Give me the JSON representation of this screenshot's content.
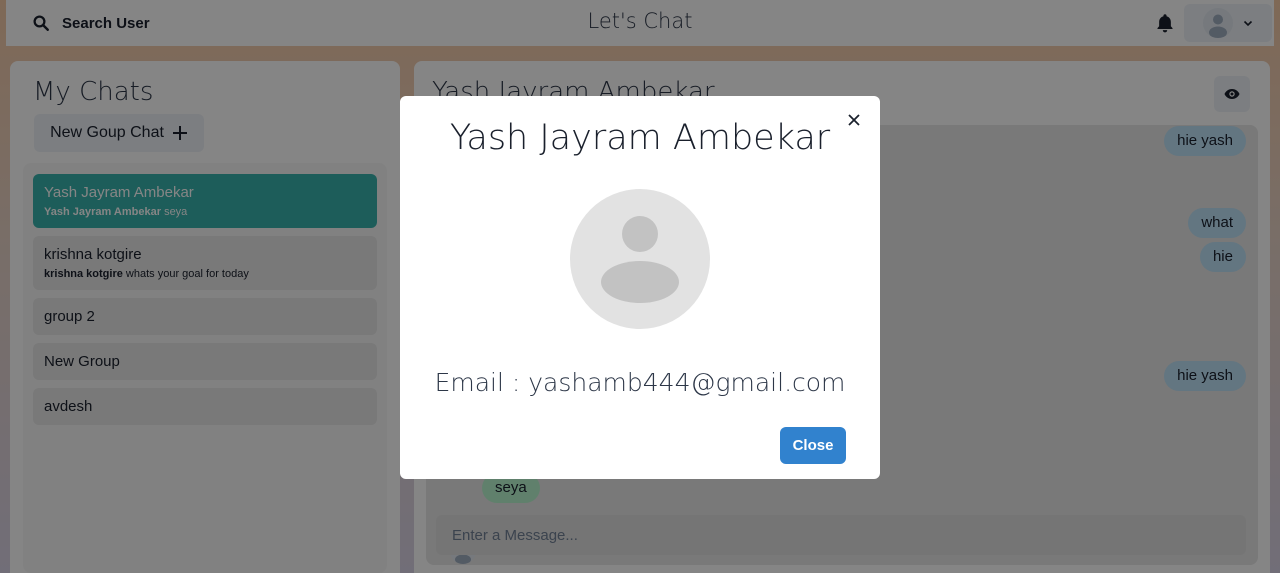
{
  "header": {
    "search_label": "Search User",
    "title": "Let's Chat",
    "icons": [
      "search-icon",
      "bell-icon",
      "avatar-icon",
      "chevron-down-icon"
    ]
  },
  "sidebar": {
    "title": "My Chats",
    "new_group_label": "New Goup Chat",
    "chats": [
      {
        "name": "Yash Jayram Ambekar",
        "sender": "Yash Jayram Ambekar",
        "preview": "seya",
        "active": true
      },
      {
        "name": "krishna kotgire",
        "sender": "krishna kotgire",
        "preview": "whats your goal for today",
        "active": false
      },
      {
        "name": "group 2"
      },
      {
        "name": "New Group"
      },
      {
        "name": "avdesh"
      }
    ]
  },
  "chat": {
    "title": "Yash Jayram Ambekar",
    "messages": [
      {
        "text": "hie yash",
        "from": "me"
      },
      {
        "text": "what",
        "from": "me"
      },
      {
        "text": "hie",
        "from": "me"
      },
      {
        "text": "hie yash",
        "from": "me"
      },
      {
        "text": "seya",
        "from": "them"
      }
    ],
    "input_placeholder": "Enter a Message..."
  },
  "modal": {
    "title": "Yash Jayram Ambekar",
    "email": "Email : yashamb444@gmail.com",
    "close_label": "Close"
  },
  "colors": {
    "active_chat": "#38b2ac",
    "my_bubble": "#bee3f8",
    "their_bubble": "#b9f5d0",
    "primary_button": "#3182ce"
  }
}
